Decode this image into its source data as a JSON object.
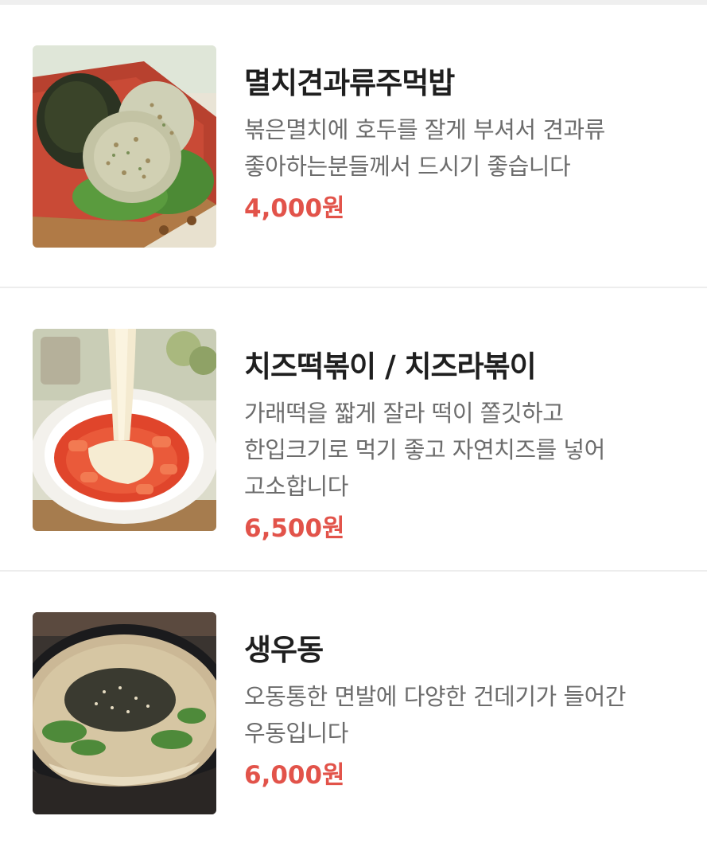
{
  "menu": {
    "items": [
      {
        "name": "멸치견과류주먹밥",
        "description": "볶은멸치에 호두를 잘게 부셔서 견과류 좋아하는분들께서 드시기 좋습니다",
        "price": "4,000원",
        "photo_icon": "rice-ball-photo-icon"
      },
      {
        "name": "치즈떡볶이 / 치즈라볶이",
        "description": "가래떡을 짧게 잘라 떡이 쫄깃하고 한입크기로 먹기 좋고 자연치즈를 넣어 고소합니다",
        "price": "6,500원",
        "photo_icon": "cheese-tteokbokki-photo-icon"
      },
      {
        "name": "생우동",
        "description": "오동통한 면발에 다양한 건데기가 들어간 우동입니다",
        "price": "6,000원",
        "photo_icon": "udon-photo-icon"
      }
    ]
  },
  "colors": {
    "price": "#e2534a",
    "name": "#1f1f1f",
    "description": "#6c6c6c",
    "divider": "#ededed"
  }
}
